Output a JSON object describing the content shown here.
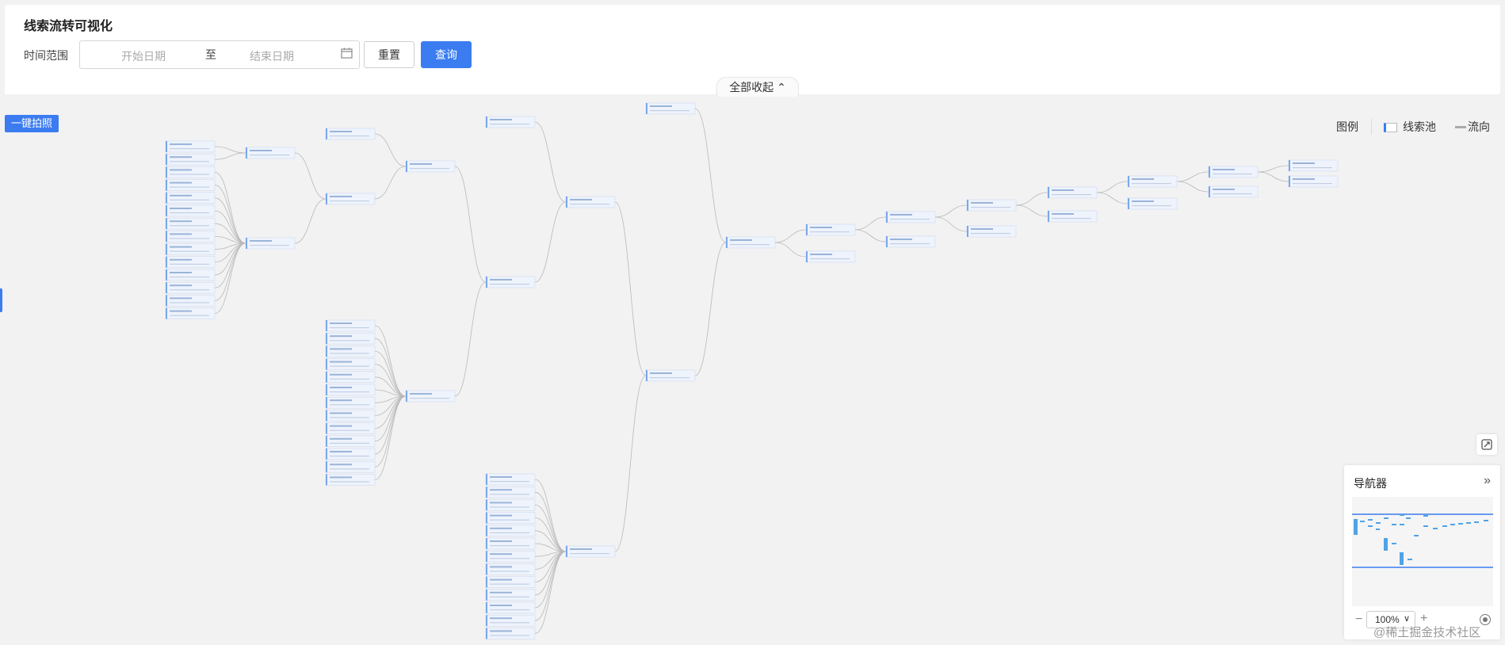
{
  "page": {
    "title": "线索流转可视化"
  },
  "filters": {
    "time_label": "时间范围",
    "start_placeholder": "开始日期",
    "separator": "至",
    "end_placeholder": "结束日期",
    "reset_label": "重置",
    "query_label": "查询"
  },
  "collapse_label": "全部收起 ⌃",
  "snapshot_label": "一键拍照",
  "legend": {
    "title": "图例",
    "pool_label": "线索池",
    "flow_label": "流向"
  },
  "navigator": {
    "title": "导航器",
    "zoom": "100%"
  },
  "watermark": "@稀土掘金技术社区",
  "colors": {
    "accent": "#3b7cf1",
    "node_bar": "#7aa7ee",
    "edge": "#b8b8b8",
    "background": "#f2f2f2"
  }
}
